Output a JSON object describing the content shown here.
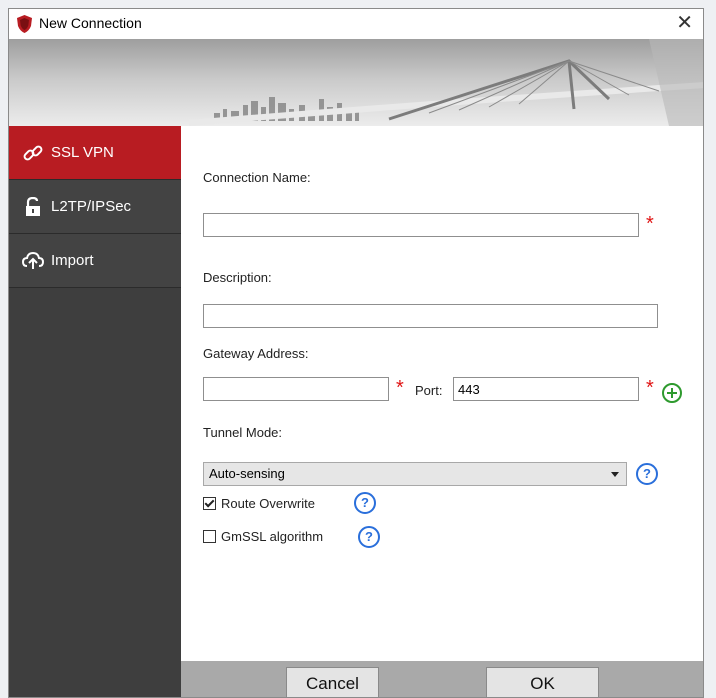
{
  "window": {
    "title": "New Connection",
    "close_glyph": "✕",
    "icon": "shield-icon"
  },
  "sidebar": {
    "items": [
      {
        "label": "SSL VPN",
        "icon": "link-icon",
        "active": true
      },
      {
        "label": "L2TP/IPSec",
        "icon": "unlock-icon",
        "active": false
      },
      {
        "label": "Import",
        "icon": "cloud-upload-icon",
        "active": false
      }
    ]
  },
  "form": {
    "connection_name": {
      "label": "Connection Name:",
      "value": "",
      "required": "*"
    },
    "description": {
      "label": "Description:",
      "value": ""
    },
    "gateway": {
      "label": "Gateway Address:",
      "value": "",
      "required": "*",
      "port_label": "Port:",
      "port_value": "443",
      "port_required": "*"
    },
    "tunnel_mode": {
      "label": "Tunnel Mode:",
      "selected": "Auto-sensing",
      "help": "?"
    },
    "route_overwrite": {
      "label": "Route Overwrite",
      "checked": true,
      "help": "?"
    },
    "gmssl": {
      "label": "GmSSL algorithm",
      "checked": false,
      "help": "?"
    }
  },
  "footer": {
    "cancel_label": "Cancel",
    "ok_label": "OK"
  },
  "colors": {
    "accent": "#b81c22",
    "sidebar": "#3e3e3e",
    "required": "#e01414",
    "help": "#2a6fdb",
    "add": "#2e9a2e"
  }
}
